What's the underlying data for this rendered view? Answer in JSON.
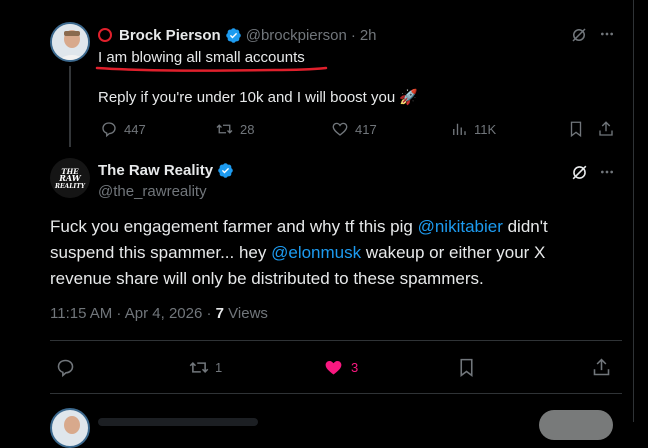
{
  "parent_tweet": {
    "display_name": "Brock Pierson",
    "handle": "@brockpierson",
    "time": "2h",
    "line1": "I am blowing all small accounts",
    "line2": "Reply if you're under 10k and I will boost you",
    "emoji": "🚀",
    "replies": "447",
    "reposts": "28",
    "likes": "417",
    "views": "11K"
  },
  "reply_tweet": {
    "display_name": "The Raw Reality",
    "handle": "@the_rawreality",
    "avatar_text": "THE RAW REALITY",
    "text_a": "Fuck you engagement farmer and why tf this pig ",
    "mention1": "@nikitabier",
    "text_b": " didn't suspend this spammer... hey ",
    "mention2": "@elonmusk",
    "text_c": " wakeup or either your X revenue share will only be distributed to these spammers.",
    "timestamp": "11:15 AM · Apr 4, 2026 · ",
    "views_count": "7",
    "views_label": " Views",
    "reposts": "1",
    "likes": "3"
  },
  "colors": {
    "accent": "#1d9bf0",
    "like": "#f91880",
    "underline": "#e0202c",
    "muted": "#71767b"
  }
}
